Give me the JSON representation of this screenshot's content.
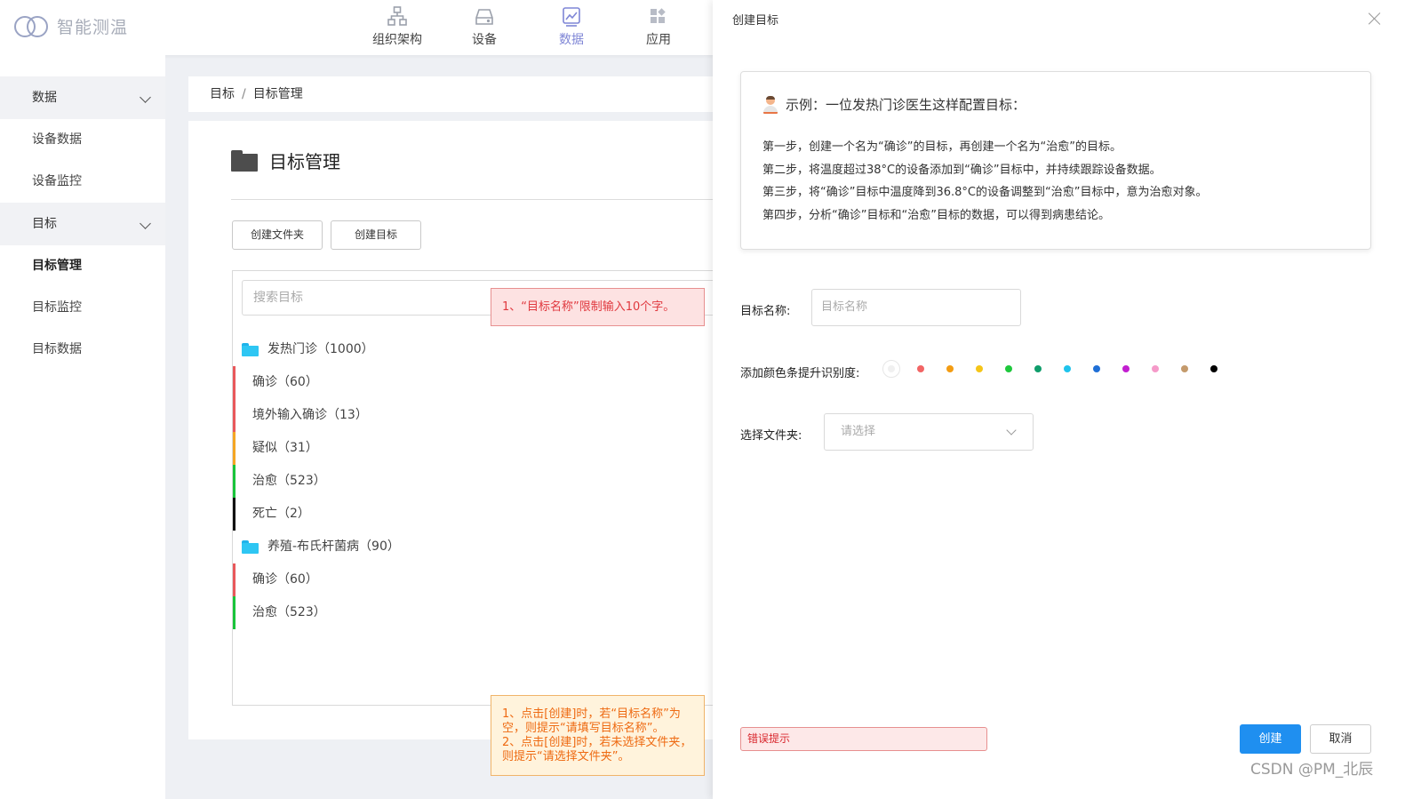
{
  "header": {
    "app_name": "智能测温",
    "nav": [
      {
        "label": "组织架构",
        "icon": "org-structure-icon"
      },
      {
        "label": "设备",
        "icon": "device-icon"
      },
      {
        "label": "数据",
        "icon": "chart-icon",
        "active": true
      },
      {
        "label": "应用",
        "icon": "apps-icon"
      }
    ]
  },
  "sidebar": {
    "groups": [
      {
        "label": "数据",
        "items": [
          "设备数据",
          "设备监控"
        ]
      },
      {
        "label": "目标",
        "items": [
          "目标管理",
          "目标监控",
          "目标数据"
        ],
        "active_item": "目标管理"
      }
    ]
  },
  "breadcrumb": [
    "目标",
    "目标管理"
  ],
  "main": {
    "title": "目标管理",
    "create_folder_button": "创建文件夹",
    "create_target_button": "创建目标",
    "search_placeholder": "搜索目标",
    "tree": [
      {
        "type": "folder",
        "label": "发热门诊（1000）"
      },
      {
        "type": "leaf",
        "label": "确诊（60）",
        "color": "#e8585b"
      },
      {
        "type": "leaf",
        "label": "境外输入确诊（13）",
        "color": "#e8585b"
      },
      {
        "type": "leaf",
        "label": "疑似（31）",
        "color": "#f5a623"
      },
      {
        "type": "leaf",
        "label": "治愈（523）",
        "color": "#19c43a"
      },
      {
        "type": "leaf",
        "label": "死亡（2）",
        "color": "#111111"
      },
      {
        "type": "folder",
        "label": "养殖-布氏杆菌病（90）"
      },
      {
        "type": "leaf",
        "label": "确诊（60）",
        "color": "#e8585b"
      },
      {
        "type": "leaf",
        "label": "治愈（523）",
        "color": "#19c43a"
      }
    ]
  },
  "annotations": {
    "note1": "1、“目标名称”限制输入10个字。",
    "note2_lines": [
      "1、点击[创建]时，若“目标名称”为空，则提示“请填写目标名称”。",
      "2、点击[创建]时，若未选择文件夹，则提示“请选择文件夹”。"
    ]
  },
  "drawer": {
    "title": "创建目标",
    "example_heading": "示例：一位发热门诊医生这样配置目标：",
    "steps": [
      "第一步，创建一个名为“确诊”的目标，再创建一个名为“治愈”的目标。",
      "第二步，将温度超过38°C的设备添加到“确诊”目标中，并持续跟踪设备数据。",
      "第三步，将“确诊”目标中温度降到36.8°C的设备调整到“治愈”目标中，意为治愈对象。",
      "第四步，分析“确诊”目标和“治愈”目标的数据，可以得到病患结论。"
    ],
    "name_label": "目标名称:",
    "name_placeholder": "目标名称",
    "color_label": "添加颜色条提升识别度:",
    "colors": [
      "#f26565",
      "#f39c12",
      "#f5c518",
      "#1ec83c",
      "#0f9d6b",
      "#1fc3ec",
      "#1f6fd6",
      "#c21ed0",
      "#f59ac9",
      "#c49a6c",
      "#000000"
    ],
    "folder_label": "选择文件夹:",
    "folder_placeholder": "请选择",
    "error_tip": "错误提示",
    "create_button": "创建",
    "cancel_button": "取消"
  },
  "watermark": "CSDN @PM_北辰"
}
